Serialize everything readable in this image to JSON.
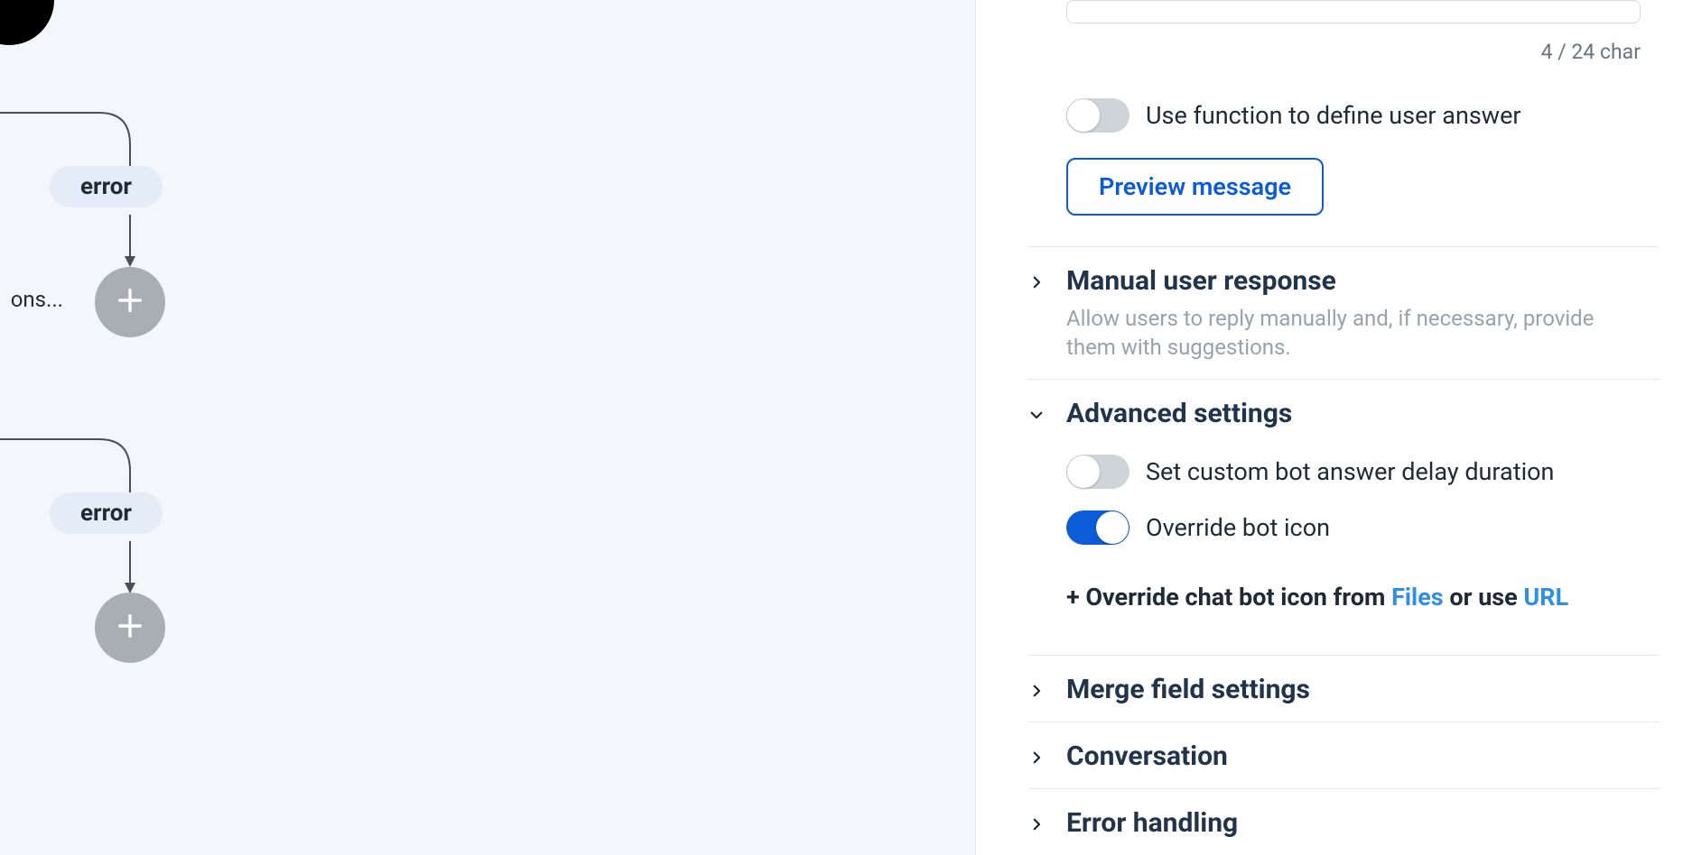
{
  "canvas": {
    "clipped_label": "ons...",
    "nodes": [
      {
        "label": "error"
      },
      {
        "label": "error"
      }
    ]
  },
  "panel": {
    "char_count": "4 / 24 char",
    "toggle_function_label": "Use function to define user answer",
    "preview_button": "Preview message",
    "sections": {
      "manual": {
        "title": "Manual user response",
        "desc": "Allow users to reply manually and, if necessary, provide them with suggestions."
      },
      "advanced": {
        "title": "Advanced settings",
        "delay_label": "Set custom bot answer delay duration",
        "override_icon_label": "Override bot icon",
        "override_line_prefix": "+ Override chat bot icon from ",
        "override_line_files": "Files",
        "override_line_middle": " or use ",
        "override_line_url": "URL"
      },
      "merge": {
        "title": "Merge field settings"
      },
      "conversation": {
        "title": "Conversation"
      },
      "error": {
        "title": "Error handling"
      }
    }
  }
}
